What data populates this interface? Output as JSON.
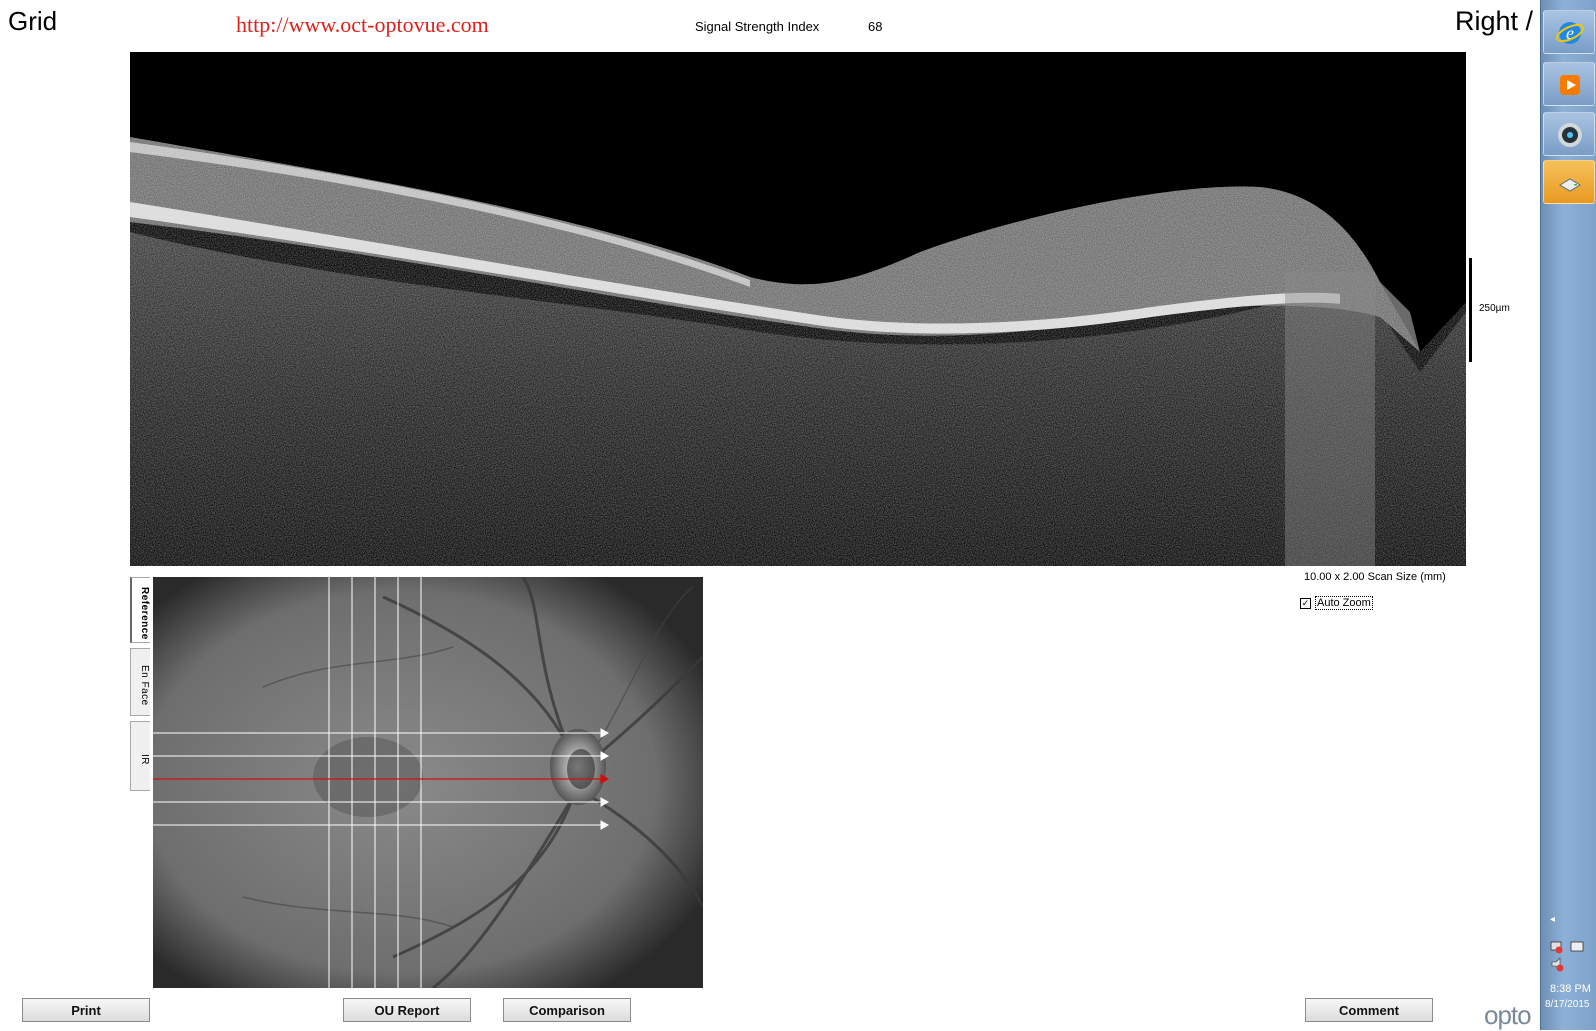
{
  "header": {
    "mode_title": "Grid",
    "watermark_url": "http://www.oct-optovue.com",
    "signal_strength_label": "Signal Strength Index",
    "signal_strength_value": "68",
    "eye_label": "Right /"
  },
  "scan": {
    "scale_label": "250µm",
    "scan_size": "10.00 x 2.00 Scan Size (mm)",
    "auto_zoom_label": "Auto Zoom",
    "auto_zoom_checked": true
  },
  "image_tabs": [
    {
      "label": "Reference",
      "active": true
    },
    {
      "label": "En Face",
      "active": false
    },
    {
      "label": "IR",
      "active": false
    }
  ],
  "buttons": {
    "print": "Print",
    "ou_report": "OU Report",
    "comparison": "Comparison",
    "comment": "Comment"
  },
  "brand_fragment": "opto",
  "taskbar": {
    "icons": [
      "internet-explorer-icon",
      "media-player-icon",
      "camera-icon",
      "drive-icon"
    ],
    "tray_arrow": "◂",
    "clock_time": "8:38 PM",
    "clock_date": "8/17/2015"
  },
  "colors": {
    "watermark": "#e0201c",
    "selected_scan_line": "#d01010",
    "taskbar": "#8db0d6"
  }
}
